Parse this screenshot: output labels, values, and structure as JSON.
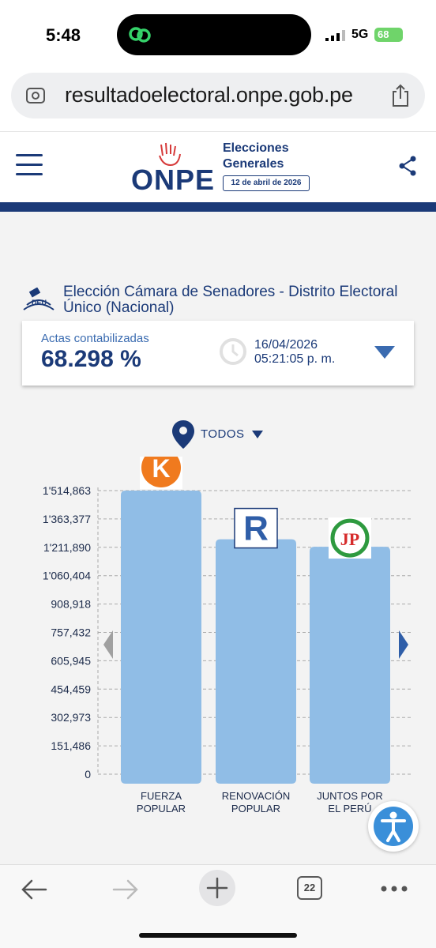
{
  "status_bar": {
    "time": "5:48",
    "network": "5G",
    "battery": "68"
  },
  "browser": {
    "url": "resultadoelectoral.onpe.gob.pe",
    "tab_count": "22"
  },
  "header": {
    "logo_text": "ONPE",
    "title_line1": "Elecciones",
    "title_line2": "Generales",
    "date": "12 de abril de 2026"
  },
  "election": {
    "badge": "DEU",
    "title": "Elección Cámara de Senadores - Distrito Electoral Único (Nacional)"
  },
  "actas": {
    "label": "Actas contabilizadas",
    "percent": "68.298 %",
    "date": "16/04/2026",
    "time": "05:21:05 p. m."
  },
  "filter": {
    "label": "TODOS"
  },
  "colors": {
    "navy": "#1b3a78",
    "bar": "#90bde6",
    "accent_blue": "#3a6bb0"
  },
  "chart_data": {
    "type": "bar",
    "categories": [
      "FUERZA POPULAR",
      "RENOVACIÓN POPULAR",
      "JUNTOS POR EL PERÚ"
    ],
    "category_lines": [
      [
        "FUERZA",
        "POPULAR"
      ],
      [
        "RENOVACIÓN",
        "POPULAR"
      ],
      [
        "JUNTOS POR",
        "EL PERÚ"
      ]
    ],
    "values": [
      1514863,
      1255000,
      1215000
    ],
    "ylim": [
      0,
      1514863
    ],
    "yticks": [
      0,
      151486,
      302973,
      454459,
      605945,
      757432,
      908918,
      1060404,
      1211890,
      1363377,
      1514863
    ],
    "ytick_labels": [
      "0",
      "151,486",
      "302,973",
      "454,459",
      "605,945",
      "757,432",
      "908,918",
      "1'060,404",
      "1'211,890",
      "1'363,377",
      "1'514,863"
    ],
    "logos": [
      "K",
      "R",
      "JP"
    ],
    "grid": true
  }
}
